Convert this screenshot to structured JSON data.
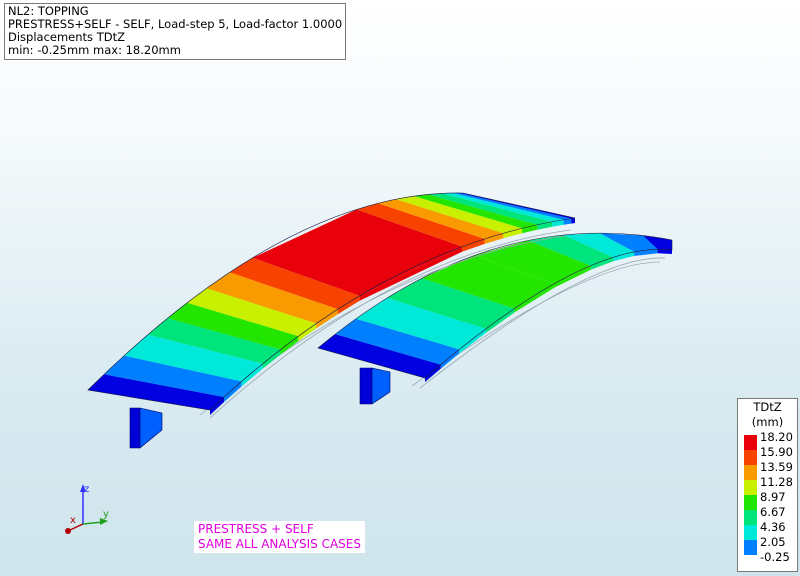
{
  "info": {
    "line1": "NL2: TOPPING",
    "line2": "PRESTRESS+SELF - SELF, Load-step 5, Load-factor 1.0000",
    "line3": "Displacements TDtZ",
    "line4": "min: -0.25mm max: 18.20mm"
  },
  "legend": {
    "title": "TDtZ",
    "unit": "(mm)",
    "levels": [
      {
        "value": "18.20",
        "color": "#e8000b"
      },
      {
        "value": "15.90",
        "color": "#f84300"
      },
      {
        "value": "13.59",
        "color": "#f99a00"
      },
      {
        "value": "11.28",
        "color": "#c8f000"
      },
      {
        "value": "8.97",
        "color": "#22e600"
      },
      {
        "value": "6.67",
        "color": "#00e47c"
      },
      {
        "value": "4.36",
        "color": "#00e8d8"
      },
      {
        "value": "2.05",
        "color": "#0080ff"
      },
      {
        "value": "-0.25",
        "color": "#0000e0"
      }
    ]
  },
  "axes": {
    "z": "z",
    "x": "x",
    "y": "y"
  },
  "note": {
    "line1": "PRESTRESS + SELF",
    "line2": "SAME ALL ANALYSIS CASES"
  }
}
